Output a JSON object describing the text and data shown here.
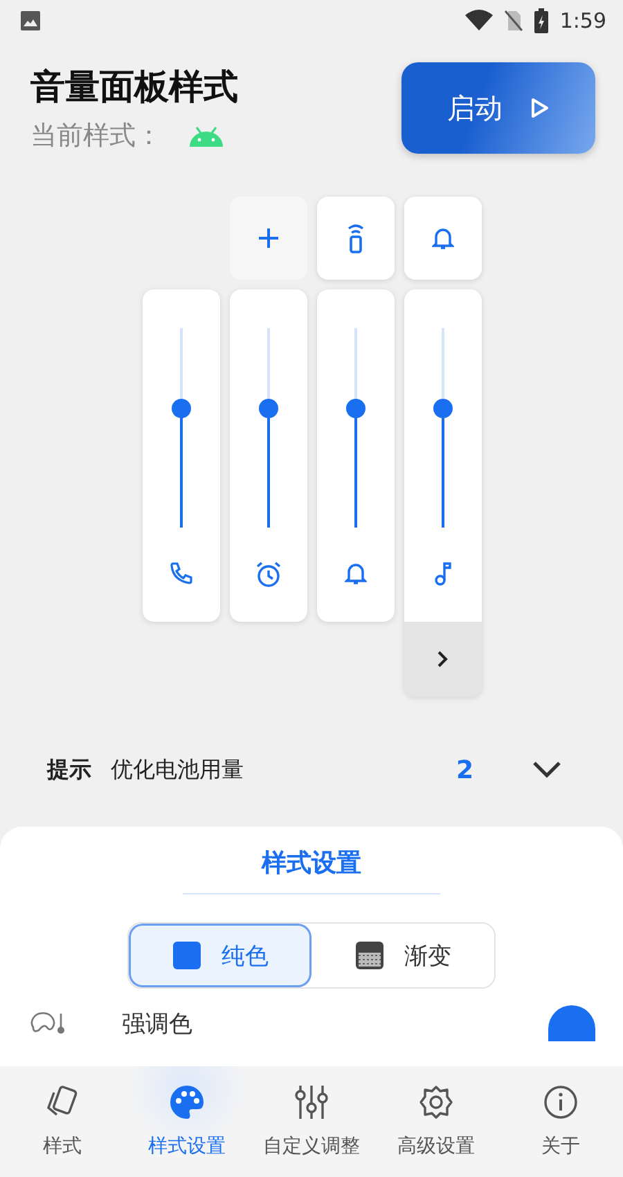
{
  "status_bar": {
    "time": "1:59"
  },
  "header": {
    "title": "音量面板样式",
    "subtitle": "当前样式：",
    "start_button": "启动"
  },
  "top_buttons": [
    {
      "kind": "add",
      "highlighted": false
    },
    {
      "kind": "remote",
      "highlighted": true
    },
    {
      "kind": "bell",
      "highlighted": true
    }
  ],
  "sliders": [
    {
      "kind": "phone",
      "level": 0.6
    },
    {
      "kind": "alarm",
      "level": 0.6
    },
    {
      "kind": "bell",
      "level": 0.6
    },
    {
      "kind": "music",
      "level": 0.6
    }
  ],
  "hint": {
    "label": "提示",
    "text": "优化电池用量",
    "count": "2"
  },
  "sheet": {
    "title": "样式设置",
    "segments": [
      {
        "label": "纯色",
        "kind": "solid",
        "selected": true
      },
      {
        "label": "渐变",
        "kind": "gradient",
        "selected": false
      }
    ],
    "rows": [
      {
        "label": "强调色",
        "color": "#1a6ff0"
      }
    ]
  },
  "nav": [
    {
      "label": "样式",
      "kind": "cards",
      "selected": false
    },
    {
      "label": "样式设置",
      "kind": "palette",
      "selected": true
    },
    {
      "label": "自定义调整",
      "kind": "sliders",
      "selected": false
    },
    {
      "label": "高级设置",
      "kind": "gear",
      "selected": false
    },
    {
      "label": "关于",
      "kind": "info",
      "selected": false
    }
  ]
}
